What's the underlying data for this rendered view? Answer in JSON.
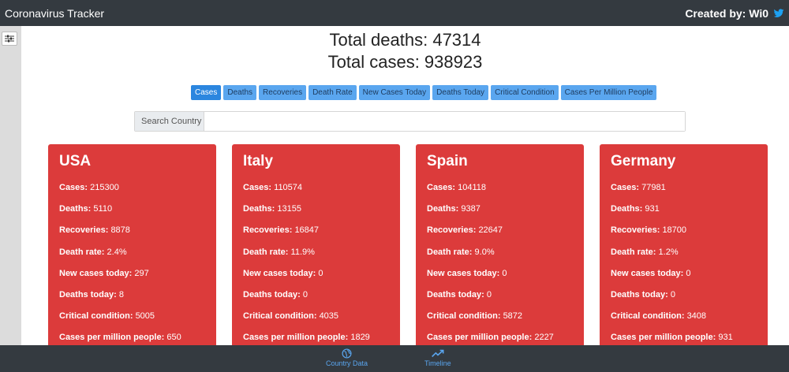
{
  "header": {
    "app_title": "Coronavirus Tracker",
    "credit": "Created by: Wi0"
  },
  "totals": {
    "deaths": "Total deaths: 47314",
    "cases": "Total cases: 938923"
  },
  "sort_buttons": [
    "Cases",
    "Deaths",
    "Recoveries",
    "Death Rate",
    "New Cases Today",
    "Deaths Today",
    "Critical Condition",
    "Cases Per Million People"
  ],
  "search": {
    "label": "Search Country",
    "value": ""
  },
  "labels": {
    "cases": "Cases:",
    "deaths": "Deaths:",
    "recoveries": "Recoveries:",
    "death_rate": "Death rate:",
    "new_cases": "New cases today:",
    "deaths_today": "Deaths today:",
    "critical": "Critical condition:",
    "per_million": "Cases per million people:"
  },
  "countries": [
    {
      "name": "USA",
      "cases": "215300",
      "deaths": "5110",
      "recoveries": "8878",
      "death_rate": "2.4%",
      "new_cases": "297",
      "deaths_today": "8",
      "critical": "5005",
      "per_million": "650"
    },
    {
      "name": "Italy",
      "cases": "110574",
      "deaths": "13155",
      "recoveries": "16847",
      "death_rate": "11.9%",
      "new_cases": "0",
      "deaths_today": "0",
      "critical": "4035",
      "per_million": "1829"
    },
    {
      "name": "Spain",
      "cases": "104118",
      "deaths": "9387",
      "recoveries": "22647",
      "death_rate": "9.0%",
      "new_cases": "0",
      "deaths_today": "0",
      "critical": "5872",
      "per_million": "2227"
    },
    {
      "name": "Germany",
      "cases": "77981",
      "deaths": "931",
      "recoveries": "18700",
      "death_rate": "1.2%",
      "new_cases": "0",
      "deaths_today": "0",
      "critical": "3408",
      "per_million": "931"
    }
  ],
  "bottom_nav": {
    "country_data": "Country Data",
    "timeline": "Timeline"
  },
  "colors": {
    "topbar": "#343a40",
    "card": "#dc3b3b",
    "button": "#5aa6ef",
    "button_active": "#2b86df"
  }
}
